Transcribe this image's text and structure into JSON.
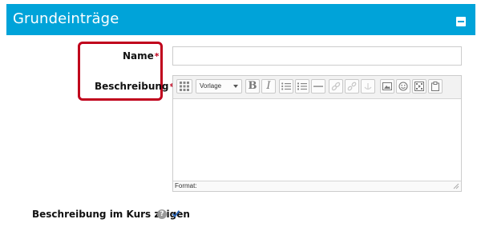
{
  "header": {
    "title": "Grundeinträge",
    "collapse_icon": "minus-square-icon"
  },
  "form": {
    "name_label": "Name",
    "description_label": "Beschreibung",
    "required_marker": "*",
    "name_value": "",
    "description_value": ""
  },
  "editor": {
    "paragraph_format": "Vorlage",
    "status_label": "Format:",
    "toolbar_icons": [
      "toolbar-toggle-icon",
      "paragraph-format-select",
      "bold-icon",
      "italic-icon",
      "unordered-list-icon",
      "ordered-list-icon",
      "horizontal-rule-icon",
      "link-icon",
      "unlink-icon",
      "anchor-icon",
      "image-icon",
      "emoji-icon",
      "media-icon",
      "paste-icon"
    ]
  },
  "show_in_course": {
    "label": "Beschreibung im Kurs zeigen",
    "help_icon": "question-icon",
    "checked": true
  },
  "colors": {
    "header_bg": "#00a3d9",
    "highlight": "#c0001c",
    "required": "#c0001c"
  }
}
